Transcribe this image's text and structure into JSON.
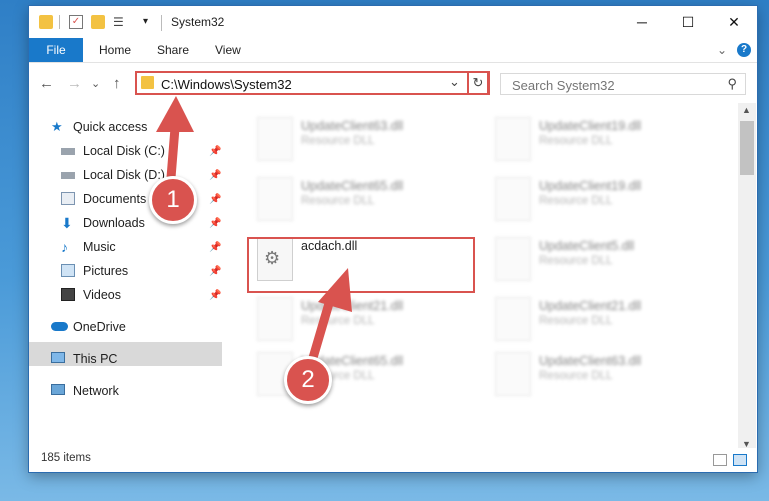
{
  "window": {
    "title": "System32",
    "controls": {
      "minimize": "─",
      "maximize": "☐",
      "close": "✕"
    }
  },
  "ribbon": {
    "tabs": [
      "File",
      "Home",
      "Share",
      "View"
    ],
    "expand": "⌄",
    "help": "?"
  },
  "address": {
    "path": "C:\\Windows\\System32",
    "dropdown": "⌄",
    "refresh": "↻"
  },
  "nav_buttons": {
    "back": "←",
    "forward": "→",
    "recent": "⌄",
    "up": "↑"
  },
  "search": {
    "placeholder": "Search System32",
    "icon": "⚲"
  },
  "sidebar": {
    "quick_access": "Quick access",
    "pinned": [
      {
        "label": "Local Disk (C:)",
        "icon": "drive-icon"
      },
      {
        "label": "Local Disk (D:)",
        "icon": "drive-icon"
      },
      {
        "label": "Documents",
        "icon": "documents-icon"
      },
      {
        "label": "Downloads",
        "icon": "downloads-icon"
      },
      {
        "label": "Music",
        "icon": "music-icon"
      },
      {
        "label": "Pictures",
        "icon": "pictures-icon"
      },
      {
        "label": "Videos",
        "icon": "videos-icon"
      }
    ],
    "onedrive": "OneDrive",
    "thispc": "This PC",
    "network": "Network",
    "pin_glyph": "📌"
  },
  "files": [
    {
      "name": "UpdateClient63.dll",
      "type": "Resource DLL"
    },
    {
      "name": "UpdateClient19.dll",
      "type": "Resource DLL"
    },
    {
      "name": "UpdateClient65.dll",
      "type": "Resource DLL"
    },
    {
      "name": "UpdateClient19.dll",
      "type": "Resource DLL"
    },
    {
      "name": "acdach.dll",
      "type": ""
    },
    {
      "name": "UpdateClient5.dll",
      "type": "Resource DLL"
    },
    {
      "name": "UpdateClient21.dll",
      "type": "Resource DLL"
    },
    {
      "name": "UpdateClient21.dll",
      "type": "Resource DLL"
    },
    {
      "name": "UpdateClient65.dll",
      "type": "Resource DLL"
    },
    {
      "name": "UpdateClient63.dll",
      "type": "Resource DLL"
    }
  ],
  "status": {
    "item_count": "185 items"
  },
  "annotations": {
    "step1": "1",
    "step2": "2",
    "accent": "#d9534f"
  }
}
